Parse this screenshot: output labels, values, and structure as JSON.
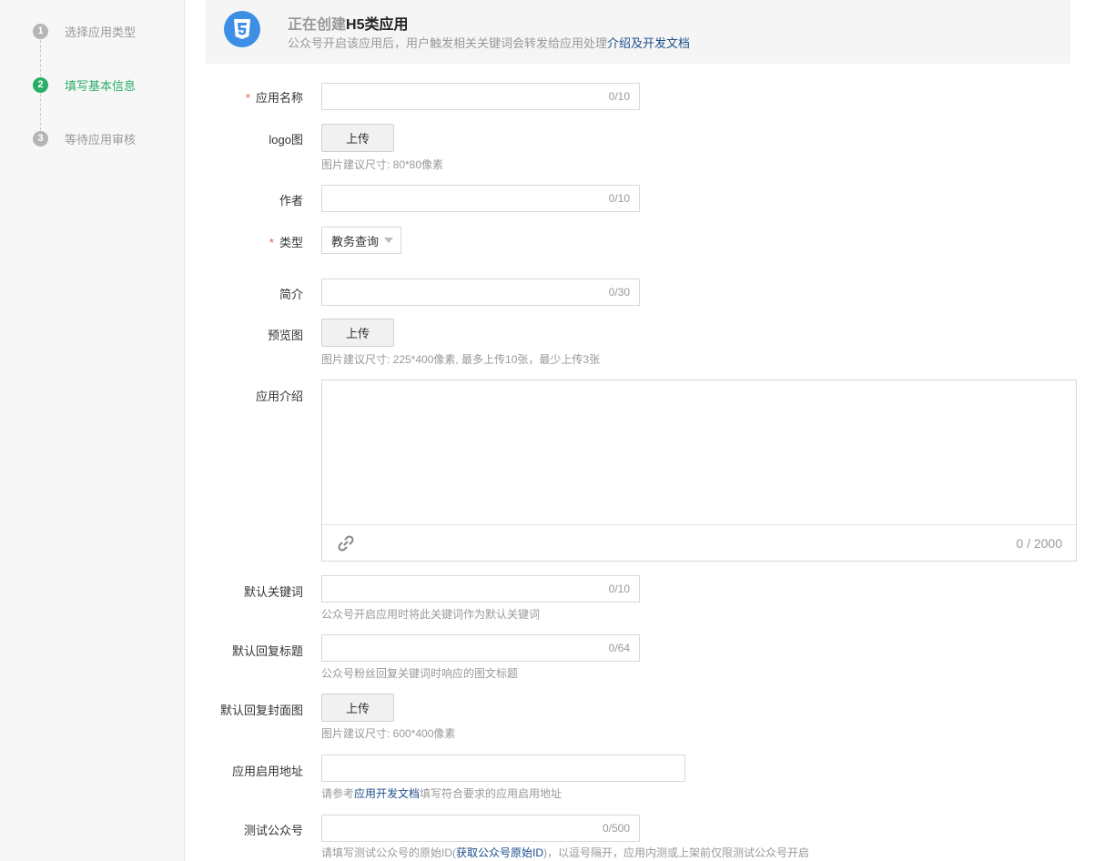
{
  "steps": [
    {
      "num": "1",
      "label": "选择应用类型"
    },
    {
      "num": "2",
      "label": "填写基本信息"
    },
    {
      "num": "3",
      "label": "等待应用审核"
    }
  ],
  "header": {
    "title_prefix": "正在创建",
    "title_strong": "H5类应用",
    "desc": "公众号开启该应用后，用户触发相关关键词会转发给应用处理",
    "desc_link": "介绍及开发文档"
  },
  "form": {
    "name": {
      "label": "应用名称",
      "count": "0/10"
    },
    "logo": {
      "label": "logo图",
      "button": "上传",
      "hint": "图片建议尺寸: 80*80像素"
    },
    "author": {
      "label": "作者",
      "count": "0/10"
    },
    "type": {
      "label": "类型",
      "selected": "教务查询"
    },
    "intro_short": {
      "label": "简介",
      "count": "0/30"
    },
    "preview": {
      "label": "预览图",
      "button": "上传",
      "hint": "图片建议尺寸: 225*400像素, 最多上传10张，最少上传3张"
    },
    "description": {
      "label": "应用介绍",
      "count": "0 / 2000"
    },
    "keyword": {
      "label": "默认关键词",
      "count": "0/10",
      "hint": "公众号开启应用时将此关键词作为默认关键词"
    },
    "reply_title": {
      "label": "默认回复标题",
      "count": "0/64",
      "hint": "公众号粉丝回复关键词时响应的图文标题"
    },
    "reply_cover": {
      "label": "默认回复封面图",
      "button": "上传",
      "hint": "图片建议尺寸: 600*400像素"
    },
    "launch_url": {
      "label": "应用启用地址",
      "hint_pre": "请参考",
      "hint_link": "应用开发文档",
      "hint_post": "填写符合要求的应用启用地址"
    },
    "test_account": {
      "label": "测试公众号",
      "count": "0/500",
      "hint_pre": "请填写测试公众号的原始ID(",
      "hint_link": "获取公众号原始ID",
      "hint_post": ")，以逗号隔开，应用内测或上架前仅限测试公众号开启"
    }
  },
  "colors": {
    "accent_green": "#2aae67",
    "link_blue": "#1f4e8c",
    "required_red": "#e15f3f",
    "h5_blue": "#3d8fe6"
  }
}
